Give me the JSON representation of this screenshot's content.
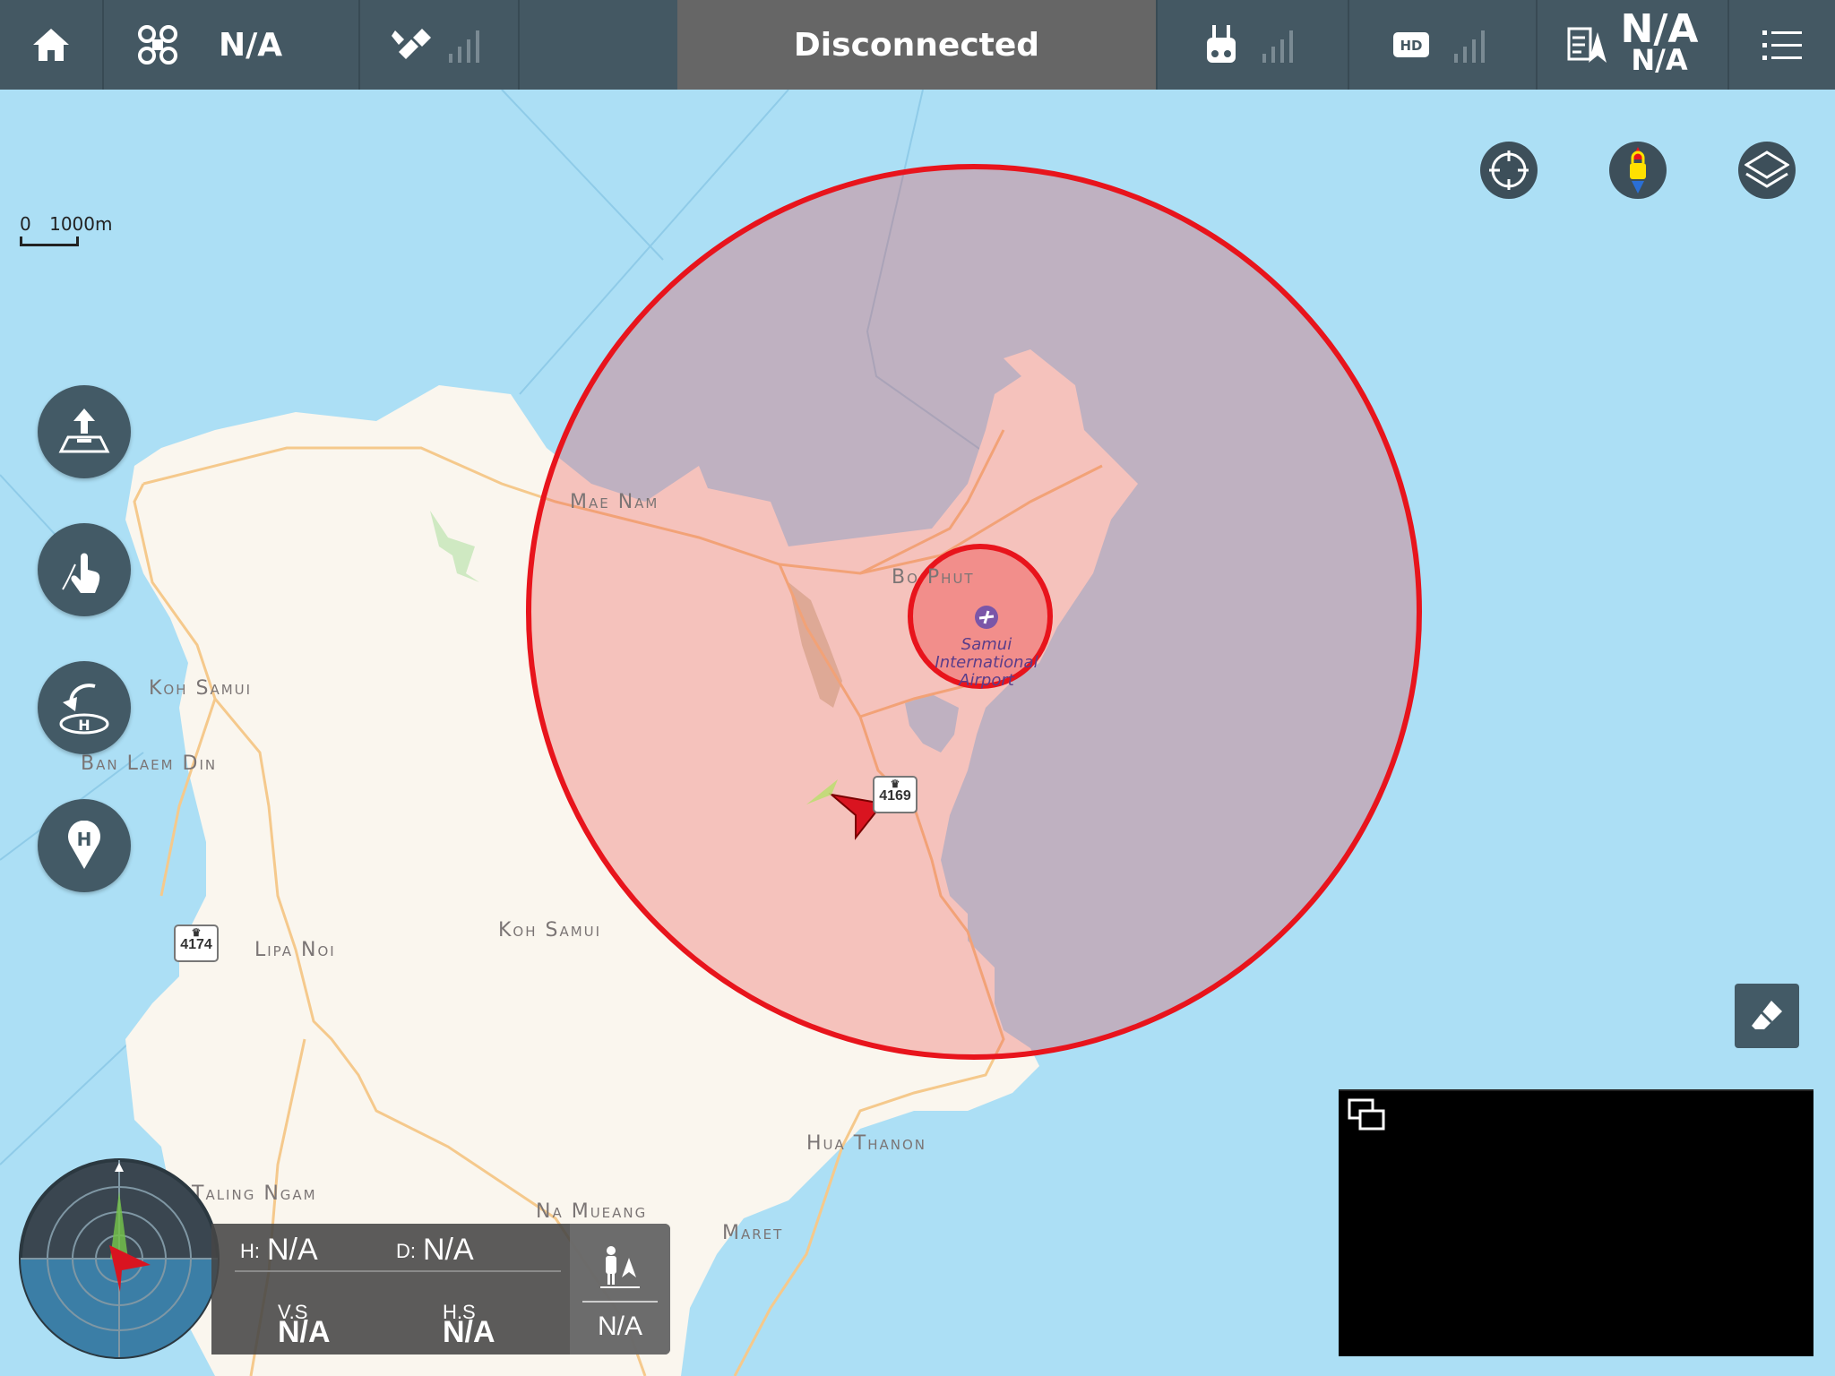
{
  "topbar": {
    "aircraft_mode": "N/A",
    "status": "Disconnected",
    "battery_top": "N/A",
    "battery_bottom": "N/A"
  },
  "map": {
    "scale_zero": "0",
    "scale_distance": "1000m",
    "labels": {
      "mae_nam": "Mae Nam",
      "bo_phut": "Bo Phut",
      "koh_samui_west": "Koh Samui",
      "ban_laem_din": "Ban Laem Din",
      "lipa_noi": "Lipa Noi",
      "koh_samui_center": "Koh Samui",
      "hua_thanon": "Hua Thanon",
      "taling_ngam": "Taling Ngam",
      "na_mueang": "Na Mueang",
      "maret": "Maret",
      "airport_line1": "Samui",
      "airport_line2": "International",
      "airport_line3": "Airport"
    },
    "road_badges": [
      "4169",
      "4174"
    ]
  },
  "telemetry": {
    "h_label": "H:",
    "h_value": "N/A",
    "d_label": "D:",
    "d_value": "N/A",
    "vs_label": "V.S",
    "vs_value": "N/A",
    "hs_label": "H.S",
    "hs_value": "N/A",
    "side_value": "N/A"
  },
  "icons": {
    "home": "home-icon",
    "aircraft": "drone-icon",
    "gps": "satellite-icon",
    "rc": "remote-controller-icon",
    "hd": "hd-video-icon",
    "menu": "list-icon",
    "locate": "crosshair-icon",
    "compass": "compass-lock-icon",
    "layers": "layers-icon",
    "eraser": "eraser-icon"
  },
  "colors": {
    "topbar": "#445863",
    "status_bg": "#666666",
    "nfz_red": "#e8141c",
    "water": "#acdff5",
    "land": "#faf6ee"
  }
}
